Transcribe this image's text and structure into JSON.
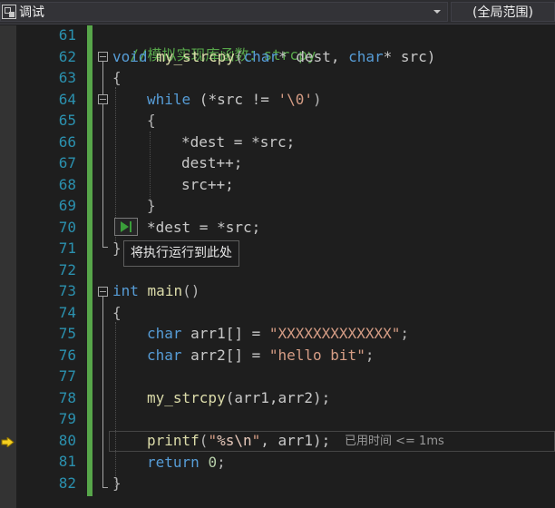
{
  "toolbar": {
    "scope_label": "调试",
    "member_label": "(全局范围)"
  },
  "line_numbers": [
    "61",
    "62",
    "63",
    "64",
    "65",
    "66",
    "67",
    "68",
    "69",
    "70",
    "71",
    "72",
    "73",
    "74",
    "75",
    "76",
    "77",
    "78",
    "79",
    "80",
    "81",
    "82"
  ],
  "code": {
    "l61": {
      "comment": "//模拟实现库函数：strcpy"
    },
    "l62": {
      "kw1": "void",
      "fn": "my_strcpy",
      "p1": "(",
      "kw2": "char",
      "p2": "* dest, ",
      "kw3": "char",
      "p3": "* src)"
    },
    "l63": {
      "text": "{"
    },
    "l64": {
      "kw": "while",
      "p1": " (*src != ",
      "ch": "'\\0'",
      "p2": ")"
    },
    "l65": {
      "text": "{"
    },
    "l66": {
      "text": "*dest = *src;"
    },
    "l67": {
      "text": "dest++;"
    },
    "l68": {
      "text": "src++;"
    },
    "l69": {
      "text": "}"
    },
    "l70": {
      "text": "*dest = *src;"
    },
    "l71": {
      "text": "}"
    },
    "l73": {
      "kw": "int",
      "fn": "main",
      "p": "()"
    },
    "l74": {
      "text": "{"
    },
    "l75": {
      "kw": "char",
      "p1": " arr1[] = ",
      "str": "\"XXXXXXXXXXXXX\"",
      "p2": ";"
    },
    "l76": {
      "kw": "char",
      "p1": " arr2[] = ",
      "str": "\"hello bit\"",
      "p2": ";"
    },
    "l78": {
      "fn": "my_strcpy",
      "p": "(arr1,arr2);"
    },
    "l80": {
      "fn": "printf",
      "p1": "(",
      "str1": "\"",
      "fmt": "%s",
      "esc": "\\n",
      "str2": "\"",
      "p2": ", arr1);"
    },
    "l81": {
      "kw": "return",
      "sp": " ",
      "num": "0",
      "p": ";"
    },
    "l82": {
      "text": "}"
    }
  },
  "perf_tip": "已用时间 <= 1ms",
  "run_to_cursor_tooltip": "将执行运行到此处",
  "colors": {
    "keyword": "#569cd6",
    "function": "#dcdcaa",
    "string": "#d69d85",
    "comment": "#57a64a",
    "line_number": "#2b91af",
    "change_bar": "#57a64a",
    "execution_arrow": "#f5d020"
  },
  "icons": {
    "scope": "class-scope-icon",
    "execution": "execution-pointer-arrow-icon",
    "run_to_cursor": "run-to-cursor-icon"
  }
}
